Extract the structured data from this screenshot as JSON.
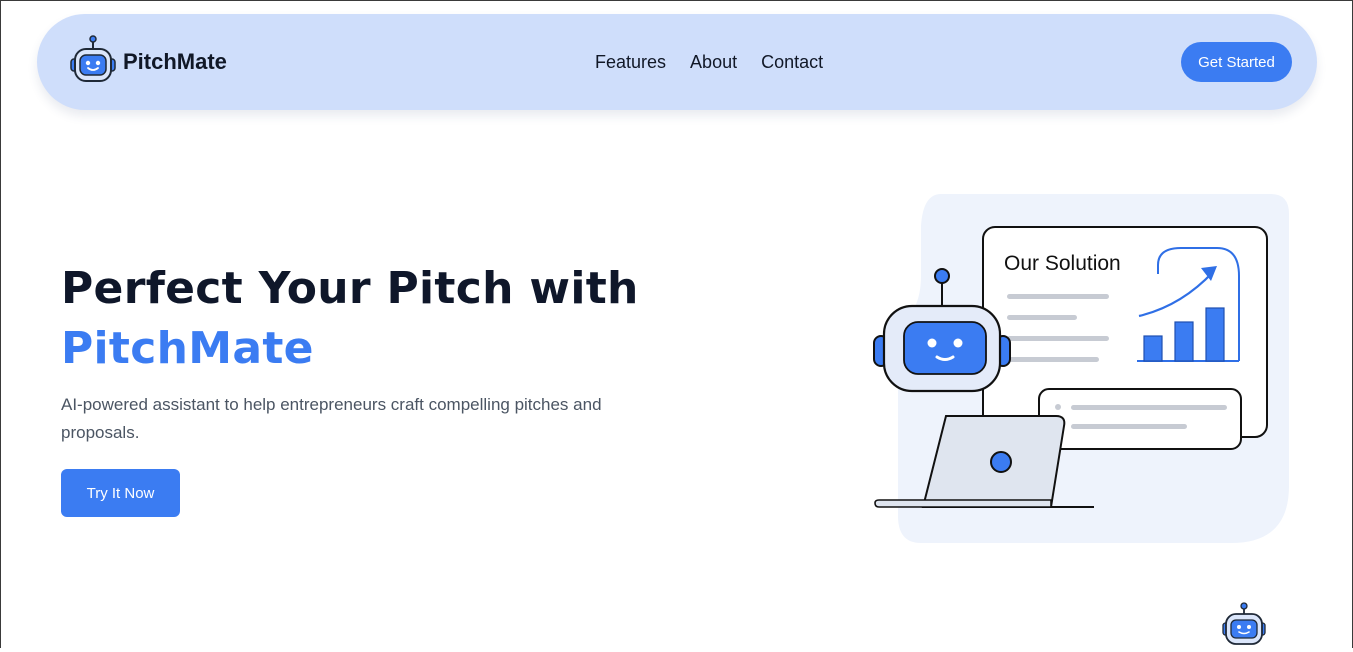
{
  "brand": {
    "name": "PitchMate",
    "logo_icon": "robot-icon"
  },
  "nav": {
    "links": [
      "Features",
      "About",
      "Contact"
    ],
    "cta_label": "Get Started"
  },
  "hero": {
    "title_line1": "Perfect Your Pitch with",
    "title_accent": "PitchMate",
    "subtitle": "AI-powered assistant to help entrepreneurs craft compelling pitches and proposals.",
    "button_label": "Try It Now"
  },
  "illustration": {
    "card_title": "Our Solution",
    "bar_levels": [
      0.35,
      0.55,
      0.75
    ]
  },
  "floating_button": {
    "icon": "robot-icon"
  },
  "colors": {
    "accent": "#3b7cf2",
    "nav_bg": "#cfdefb",
    "heading": "#0f172a",
    "body_text": "#4b5563"
  }
}
